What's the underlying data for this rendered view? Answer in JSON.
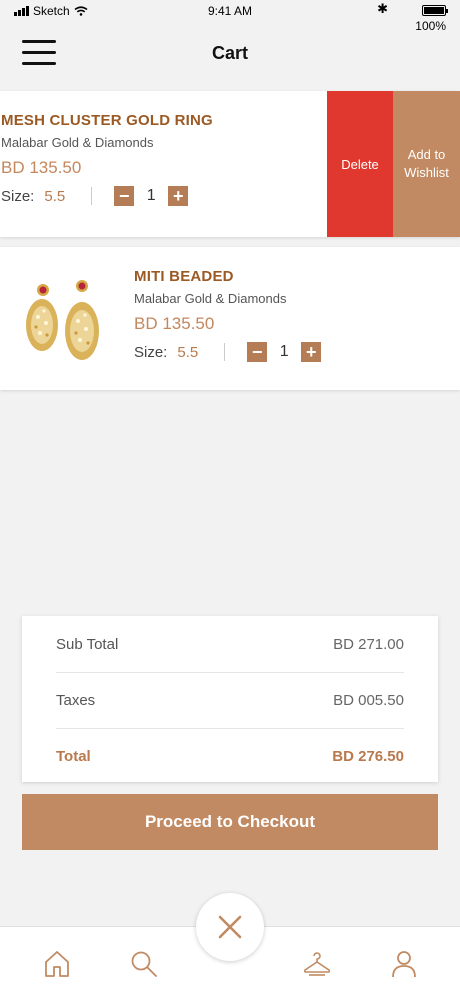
{
  "status_bar": {
    "carrier": "Sketch",
    "time": "9:41 AM",
    "bluetooth": "✱",
    "battery_pct": "100%"
  },
  "header": {
    "title": "Cart",
    "menu_icon": "hamburger-menu-icon"
  },
  "cart_items": [
    {
      "name": "MESH CLUSTER GOLD RING",
      "brand": "Malabar Gold & Diamonds",
      "price": "BD 135.50",
      "size_label": "Size:",
      "size_value": "5.5",
      "quantity": "1",
      "minus": "−",
      "plus": "+",
      "actions": {
        "delete": "Delete",
        "wishlist": "Add to Wishlist"
      }
    },
    {
      "name": "MITI BEADED",
      "brand": "Malabar Gold & Diamonds",
      "price": "BD 135.50",
      "size_label": "Size:",
      "size_value": "5.5",
      "quantity": "1",
      "minus": "−",
      "plus": "+"
    }
  ],
  "summary": {
    "subtotal_label": "Sub Total",
    "subtotal_value": "BD 271.00",
    "taxes_label": "Taxes",
    "taxes_value": "BD 005.50",
    "total_label": "Total",
    "total_value": "BD 276.50"
  },
  "checkout": {
    "label": "Proceed to Checkout"
  },
  "bottom_nav": {
    "items": [
      "home-icon",
      "search-icon",
      "close-icon",
      "hanger-icon",
      "profile-icon"
    ]
  },
  "colors": {
    "accent": "#c18a62",
    "title_brown": "#9b5a24",
    "delete_red": "#e0382f"
  }
}
